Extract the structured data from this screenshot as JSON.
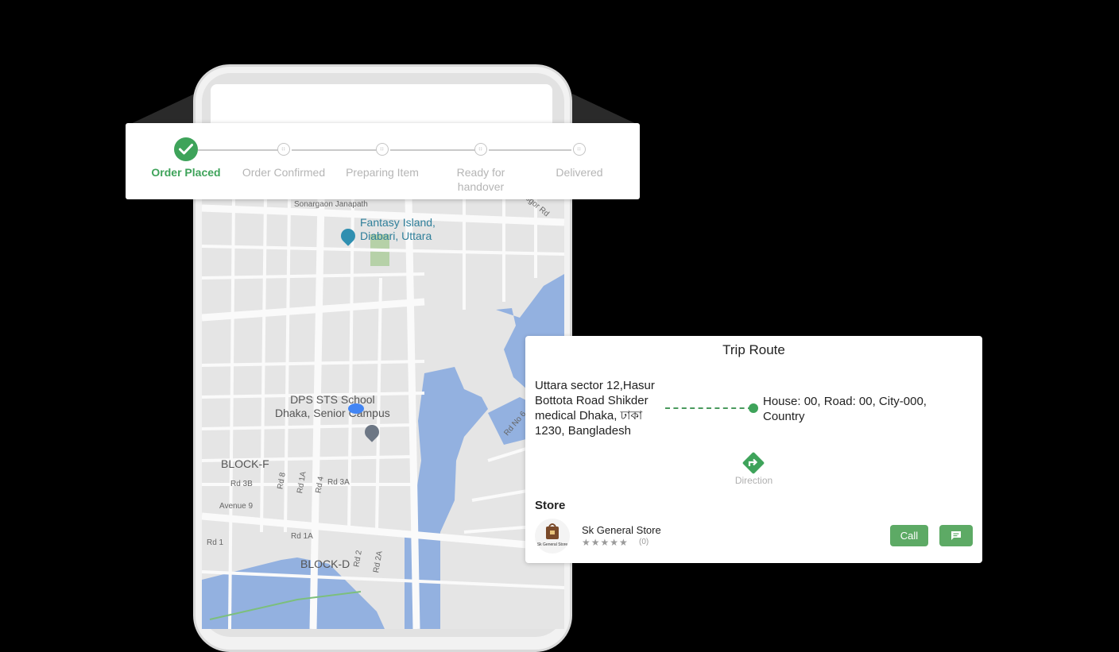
{
  "tracker": {
    "steps": [
      {
        "label": "Order Placed",
        "state": "done"
      },
      {
        "label": "Order Confirmed",
        "state": "pending"
      },
      {
        "label": "Preparing Item",
        "state": "pending"
      },
      {
        "label": "Ready for handover",
        "state": "pending"
      },
      {
        "label": "Delivered",
        "state": "pending"
      }
    ]
  },
  "map": {
    "labels": {
      "sonargaon": "Sonargaon Janapath",
      "fantasy": "Fantasy Island,\nDiabari, Uttara",
      "school": "DPS STS School\nDhaka, Senior Campus",
      "block_f": "BLOCK-F",
      "block_d": "BLOCK-D",
      "rd3b": "Rd 3B",
      "rd8": "Rd 8",
      "rd1a_v": "Rd 1A",
      "rd4": "Rd 4",
      "rd3a": "Rd 3A",
      "avenue9": "Avenue 9",
      "rd1a_h": "Rd 1A",
      "rd1": "Rd 1",
      "rd2": "Rd 2",
      "rd2a": "Rd 2A",
      "rdno": "Rd No 6",
      "gor": "Bogor Rd"
    }
  },
  "trip": {
    "title": "Trip Route",
    "from_address": "Uttara sector 12,Hasur Bottota Road Shikder medical Dhaka, ঢাকা 1230, Bangladesh",
    "to_address": "House: 00, Road: 00, City-000, Country",
    "direction_label": "Direction",
    "store_heading": "Store",
    "store_name": "Sk General Store",
    "store_logo_text": "Sk General Store",
    "rating_stars": "★★★★★",
    "rating_count": "(0)",
    "call_label": "Call"
  },
  "colors": {
    "accent_green": "#3ea35a",
    "water": "#93b1e0",
    "map_bg": "#e5e5e5"
  }
}
